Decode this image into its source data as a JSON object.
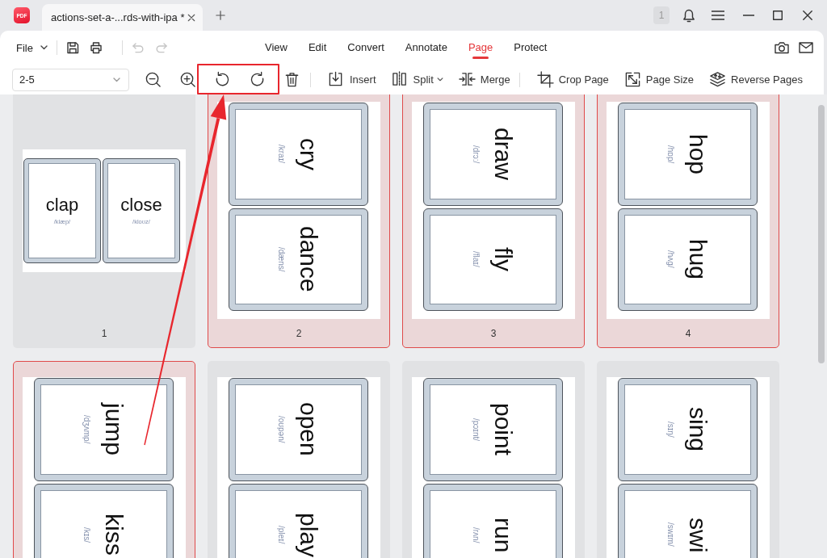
{
  "app": {
    "logo_text": "PDF"
  },
  "document_tabs": [
    {
      "title": "actions-set-a-...rds-with-ipa *",
      "selected": true
    }
  ],
  "title_bar": {
    "notification_count": "1"
  },
  "file_menu": {
    "label": "File"
  },
  "quick_actions": [
    [
      {
        "kind": "save",
        "disabled": false
      },
      {
        "kind": "print",
        "disabled": false
      }
    ],
    [
      {
        "kind": "undo",
        "disabled": true
      },
      {
        "kind": "redo",
        "disabled": true
      }
    ]
  ],
  "ribbon_tabs": [
    {
      "label": "View",
      "selected": false
    },
    {
      "label": "Edit",
      "selected": false
    },
    {
      "label": "Convert",
      "selected": false
    },
    {
      "label": "Annotate",
      "selected": false
    },
    {
      "label": "Page",
      "selected": true
    },
    {
      "label": "Protect",
      "selected": false
    }
  ],
  "page_range": {
    "value": "2-5"
  },
  "tool_groups": [
    [
      {
        "kind": "zoom-out"
      },
      {
        "kind": "zoom-in"
      },
      {
        "kind": "rotate-left"
      },
      {
        "kind": "rotate-right"
      },
      {
        "kind": "delete"
      }
    ],
    [
      {
        "kind": "insert",
        "label": "Insert",
        "has_menu": false
      },
      {
        "kind": "split",
        "label": "Split",
        "has_menu": true
      },
      {
        "kind": "merge",
        "label": "Merge",
        "has_menu": false
      }
    ],
    [
      {
        "kind": "crop",
        "label": "Crop Page",
        "has_menu": false
      },
      {
        "kind": "page-size",
        "label": "Page Size",
        "has_menu": false
      },
      {
        "kind": "reverse",
        "label": "Reverse Pages",
        "has_menu": false
      }
    ]
  ],
  "pages": [
    {
      "number": "1",
      "selected": false,
      "kind": "landscape",
      "cards": [
        {
          "word": "clap",
          "ipa": "/klæp/"
        },
        {
          "word": "close",
          "ipa": "/kloʊz/"
        }
      ]
    },
    {
      "number": "2",
      "selected": true,
      "kind": "portrait",
      "cards": [
        {
          "word": "cry",
          "ipa": "/kraɪ/"
        },
        {
          "word": "dance",
          "ipa": "/dæns/"
        }
      ]
    },
    {
      "number": "3",
      "selected": true,
      "kind": "portrait",
      "cards": [
        {
          "word": "draw",
          "ipa": "/drɔː/"
        },
        {
          "word": "fly",
          "ipa": "/flaɪ/"
        }
      ]
    },
    {
      "number": "4",
      "selected": true,
      "kind": "portrait",
      "cards": [
        {
          "word": "hop",
          "ipa": "/hɒp/"
        },
        {
          "word": "hug",
          "ipa": "/hʌg/"
        }
      ]
    },
    {
      "selected": true,
      "kind": "portrait",
      "cards": [
        {
          "word": "jump",
          "ipa": "/dʒʌmp/"
        },
        {
          "word": "kiss",
          "ipa": "/kɪs/"
        }
      ]
    },
    {
      "selected": false,
      "kind": "portrait",
      "cards": [
        {
          "word": "open",
          "ipa": "/oʊpən/"
        },
        {
          "word": "play",
          "ipa": "/pleɪ/"
        }
      ]
    },
    {
      "selected": false,
      "kind": "portrait",
      "cards": [
        {
          "word": "point",
          "ipa": "/pɔɪnt/"
        },
        {
          "word": "run",
          "ipa": "/rʌn/"
        }
      ]
    },
    {
      "selected": false,
      "kind": "portrait",
      "cards": [
        {
          "word": "sing",
          "ipa": "/sɪŋ/"
        },
        {
          "word": "swi",
          "ipa": "/swɪm/"
        }
      ]
    }
  ]
}
